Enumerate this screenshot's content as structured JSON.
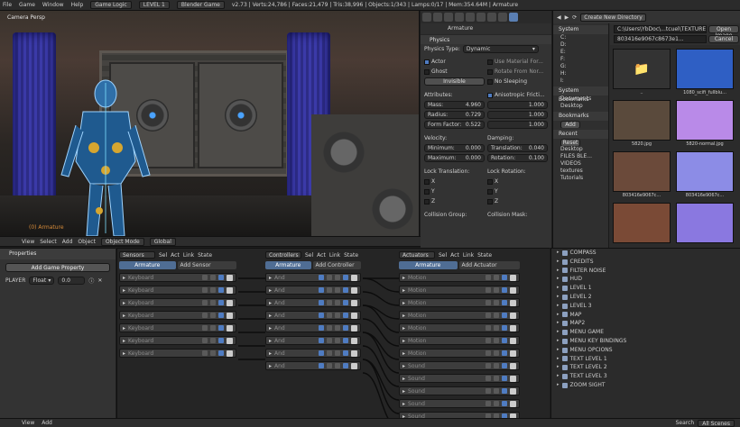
{
  "topbar": {
    "menus": [
      "File",
      "Game",
      "Window",
      "Help"
    ],
    "screen_layout": "Game Logic",
    "scene": "LEVEL 1",
    "engine": "Blender Game",
    "stats": "v2.73 | Verts:24,786 | Faces:21,479 | Tris:38,996 | Objects:1/343 | Lamps:0/17 | Mem:354.64M | Armature"
  },
  "viewport": {
    "label": "Camera Persp",
    "object_label": "(0) Armature",
    "header": {
      "menus": [
        "View",
        "Select",
        "Add",
        "Object"
      ],
      "mode": "Object Mode",
      "pivot": "Global"
    }
  },
  "properties": {
    "crumb": "Armature",
    "panel_title": "Physics",
    "physics_type_label": "Physics Type:",
    "physics_type_value": "Dynamic",
    "actor_label": "Actor",
    "ghost_label": "Ghost",
    "invisible_label": "Invisible",
    "use_material_label": "Use Material For...",
    "rotate_label": "Rotate From Nor...",
    "no_sleeping_label": "No Sleeping",
    "attributes_label": "Attributes:",
    "mass_label": "Mass:",
    "mass_value": "4.960",
    "radius_label": "Radius:",
    "radius_value": "0.729",
    "form_factor_label": "Form Factor:",
    "form_factor_value": "0.522",
    "aniso_label": "Anisotropic Fricti...",
    "aniso_values": [
      "1.000",
      "1.000",
      "1.000"
    ],
    "velocity_label": "Velocity:",
    "min_label": "Minimum:",
    "min_value": "0.000",
    "max_label": "Maximum:",
    "max_value": "0.000",
    "damping_label": "Damping:",
    "translation_label": "Translation:",
    "translation_value": "0.040",
    "rotation_label": "Rotation:",
    "rotation_value": "0.100",
    "lock_translation_label": "Lock Translation:",
    "lock_rotation_label": "Lock Rotation:",
    "axes": [
      "X",
      "Y",
      "Z"
    ],
    "collision_group_label": "Collision Group:",
    "collision_mask_label": "Collision Mask:"
  },
  "file_browser": {
    "create_dir_label": "Create New Directory",
    "open_label": "Open Image",
    "cancel_label": "Cancel",
    "path": "C:\\Users\\YbDoc\\...tcuel\\TEXTURES\\",
    "filename": "803416e9067c8673e1...",
    "system_header": "System",
    "drives": [
      "C:",
      "D:",
      "E:",
      "F:",
      "G:",
      "H:",
      "I:"
    ],
    "bookmarks_system_header": "System Bookmarks",
    "system_bookmarks": [
      "Documents",
      "Desktop"
    ],
    "bookmarks_header": "Bookmarks",
    "add_label": "Add",
    "recent_header": "Recent",
    "reset_label": "Reset",
    "recent": [
      "Desktop",
      "FILES BLE...",
      "VIDEOS",
      "textures",
      "Tutorials"
    ],
    "thumbs": [
      {
        "name": "..",
        "color": "#333333"
      },
      {
        "name": "1080_scifi_fullblu...",
        "color": "#2f5fc4"
      },
      {
        "name": "5820.jpg",
        "color": "#5a4a3c"
      },
      {
        "name": "5820-normal.jpg",
        "color": "#b98ae8"
      },
      {
        "name": "803416e9067c...",
        "color": "#6b4a3a"
      },
      {
        "name": "803416e9067c...",
        "color": "#8c8ce6"
      },
      {
        "name": "",
        "color": "#7a4a36"
      },
      {
        "name": "",
        "color": "#8a78e0"
      }
    ]
  },
  "game_properties": {
    "header": "Properties",
    "add_label": "Add Game Property",
    "prop_name": "PLAYER",
    "prop_type": "Float",
    "prop_value": "0.0"
  },
  "logic": {
    "sensors_label": "Sensors",
    "controllers_label": "Controllers",
    "actuators_label": "Actuators",
    "flags": [
      "Sel",
      "Act",
      "Link",
      "State"
    ],
    "object_label": "Armature",
    "add_sensor": "Add Sensor",
    "add_controller": "Add Controller",
    "add_actuator": "Add Actuator",
    "sensors": [
      "Keyboard",
      "Keyboard",
      "Keyboard",
      "Keyboard",
      "Keyboard",
      "Keyboard",
      "Keyboard"
    ],
    "controllers": [
      "And",
      "And",
      "And",
      "And",
      "And",
      "And",
      "And",
      "And"
    ],
    "actuators": [
      "Motion",
      "Motion",
      "Motion",
      "Motion",
      "Motion",
      "Motion",
      "Motion",
      "Sound",
      "Sound",
      "Sound",
      "Sound",
      "Sound"
    ]
  },
  "outliner": {
    "items": [
      "COMPASS",
      "CREDITS",
      "FILTER NOISE",
      "HUD",
      "LEVEL 1",
      "LEVEL 2",
      "LEVEL 3",
      "MAP",
      "MAP2",
      "MENU GAME",
      "MENU KEY BINDINGS",
      "MENU OPCIONS",
      "TEXT LEVEL 1",
      "TEXT LEVEL 2",
      "TEXT LEVEL 3",
      "ZOOM SIGHT"
    ]
  },
  "bottombar": {
    "menus": [
      "View",
      "Add"
    ],
    "search_label": "Search",
    "scenes_value": "All Scenes"
  }
}
